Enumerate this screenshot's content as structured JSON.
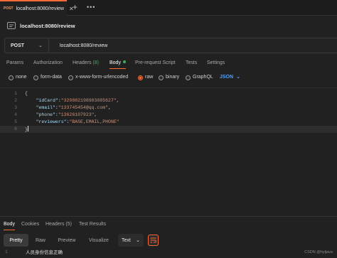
{
  "tab": {
    "method": "POST",
    "url": "localhost:8080/review",
    "close_icon": "close-icon",
    "method_color": "#ff9a55"
  },
  "request": {
    "name": "localhost:8080/review",
    "method": "POST",
    "url": "localhost:8080/review"
  },
  "request_tabs": [
    {
      "label": "Params"
    },
    {
      "label": "Authorization"
    },
    {
      "label": "Headers",
      "count": "(8)"
    },
    {
      "label": "Body",
      "active": true
    },
    {
      "label": "Pre-request Script"
    },
    {
      "label": "Tests"
    },
    {
      "label": "Settings"
    }
  ],
  "body_types": [
    {
      "label": "none"
    },
    {
      "label": "form-data"
    },
    {
      "label": "x-www-form-urlencoded"
    },
    {
      "label": "raw",
      "selected": true
    },
    {
      "label": "binary"
    },
    {
      "label": "GraphQL"
    }
  ],
  "language": "JSON",
  "editor": {
    "lines": [
      {
        "n": "1",
        "text": "{"
      },
      {
        "n": "2",
        "key": "\"idCard\"",
        "value": "\"320882198903085627\"",
        "tail": ","
      },
      {
        "n": "3",
        "key": "\"email\"",
        "value": "\"133745454@qq.com\"",
        "tail": ","
      },
      {
        "n": "4",
        "key": "\"phone\"",
        "value": "\"13626107923\"",
        "tail": ","
      },
      {
        "n": "5",
        "key": "\"reviewers\"",
        "value": "\"BASE,EMAIL,PHONE\"",
        "tail": ""
      },
      {
        "n": "6",
        "text": "}"
      }
    ]
  },
  "response_tabs": [
    {
      "label": "Body",
      "active": true
    },
    {
      "label": "Cookies"
    },
    {
      "label": "Headers",
      "count": "(5)"
    },
    {
      "label": "Test Results"
    }
  ],
  "view_modes": [
    {
      "label": "Pretty",
      "active": true
    },
    {
      "label": "Raw"
    },
    {
      "label": "Preview"
    },
    {
      "label": "Visualize"
    }
  ],
  "format": "Text",
  "response": {
    "line_number": "1",
    "text": "人员身份信息正确"
  },
  "watermark": "CSDN @hyljava",
  "colors": {
    "accent": "#ff6c37",
    "success": "#3fae5f",
    "json_blue": "#4a9fff"
  }
}
